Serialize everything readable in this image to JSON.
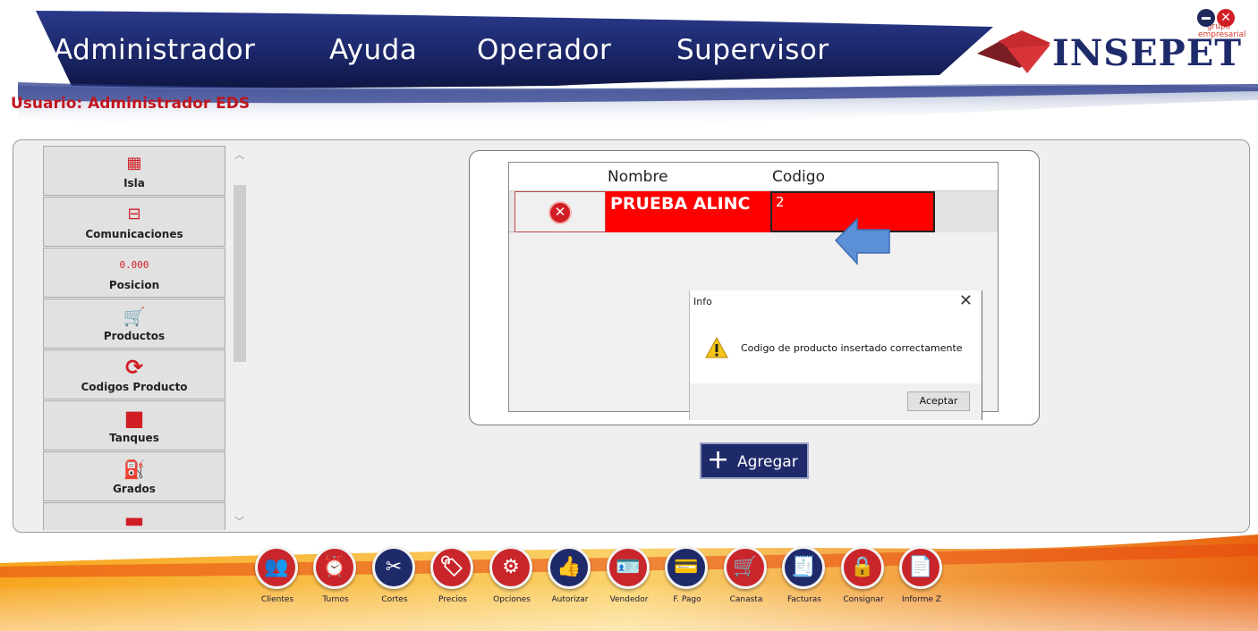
{
  "header": {
    "menu": [
      {
        "label": "Administrador",
        "active": true
      },
      {
        "label": "Ayuda",
        "active": false
      },
      {
        "label": "Operador",
        "active": false
      },
      {
        "label": "Supervisor",
        "active": false
      }
    ],
    "user_label": "Usuario: Administrador EDS",
    "logo_text": "INSEPET",
    "logo_sub": "grupo empresarial",
    "close_glyph": "✕"
  },
  "sidebar": {
    "items": [
      {
        "label": "Isla",
        "icon": "pumps-icon",
        "glyph": "▦"
      },
      {
        "label": "Comunicaciones",
        "icon": "network-icon",
        "glyph": "⊟"
      },
      {
        "label": "Posicion",
        "icon": "digital-display-icon",
        "glyph": "0.000"
      },
      {
        "label": "Productos",
        "icon": "cart-icon",
        "glyph": "🛒"
      },
      {
        "label": "Codigos Producto",
        "icon": "refresh-icon",
        "glyph": "⟳"
      },
      {
        "label": "Tanques",
        "icon": "tank-icon",
        "glyph": "■"
      },
      {
        "label": "Grados",
        "icon": "fuel-nozzle-icon",
        "glyph": "⛽"
      },
      {
        "label": "",
        "icon": "tank-icon",
        "glyph": "▬"
      }
    ]
  },
  "grid": {
    "columns": [
      "Nombre",
      "Codigo"
    ],
    "rows": [
      {
        "nombre": "PRUEBA ALINC",
        "codigo": "2"
      }
    ],
    "delete_glyph": "✕"
  },
  "dialog": {
    "title": "Info",
    "close_glyph": "✕",
    "message": "Codigo de producto insertado correctamente",
    "ok_label": "Aceptar"
  },
  "add_button": {
    "plus": "+",
    "label": "Agregar"
  },
  "footer": {
    "buttons": [
      {
        "label": "Clientes",
        "icon": "users-icon",
        "glyph": "👥"
      },
      {
        "label": "Turnos",
        "icon": "alarm-clock-icon",
        "glyph": "⏰"
      },
      {
        "label": "Cortes",
        "icon": "scissors-icon",
        "glyph": "✂"
      },
      {
        "label": "Precios",
        "icon": "price-tag-icon",
        "glyph": "🏷"
      },
      {
        "label": "Opciones",
        "icon": "gears-icon",
        "glyph": "⚙"
      },
      {
        "label": "Autorizar",
        "icon": "thumbs-up-icon",
        "glyph": "👍"
      },
      {
        "label": "Vendedor",
        "icon": "id-card-icon",
        "glyph": "🪪"
      },
      {
        "label": "F. Pago",
        "icon": "payment-card-icon",
        "glyph": "💳"
      },
      {
        "label": "Canasta",
        "icon": "cart-icon",
        "glyph": "🛒"
      },
      {
        "label": "Facturas",
        "icon": "invoice-icon",
        "glyph": "🧾"
      },
      {
        "label": "Consignar",
        "icon": "safe-icon",
        "glyph": "🔒"
      },
      {
        "label": "Informe Z",
        "icon": "report-icon",
        "glyph": "📄"
      }
    ]
  },
  "colors": {
    "brand_red": "#e5161d",
    "brand_navy": "#1f2a6b",
    "row_highlight": "#ff0000",
    "footer_buttons": [
      "#c8262b",
      "#c8262b",
      "#1f2a6b",
      "#c8262b",
      "#c8262b",
      "#1f2a6b",
      "#c8262b",
      "#1f2a6b",
      "#c8262b",
      "#1f2a6b",
      "#c8262b",
      "#c8262b"
    ]
  }
}
